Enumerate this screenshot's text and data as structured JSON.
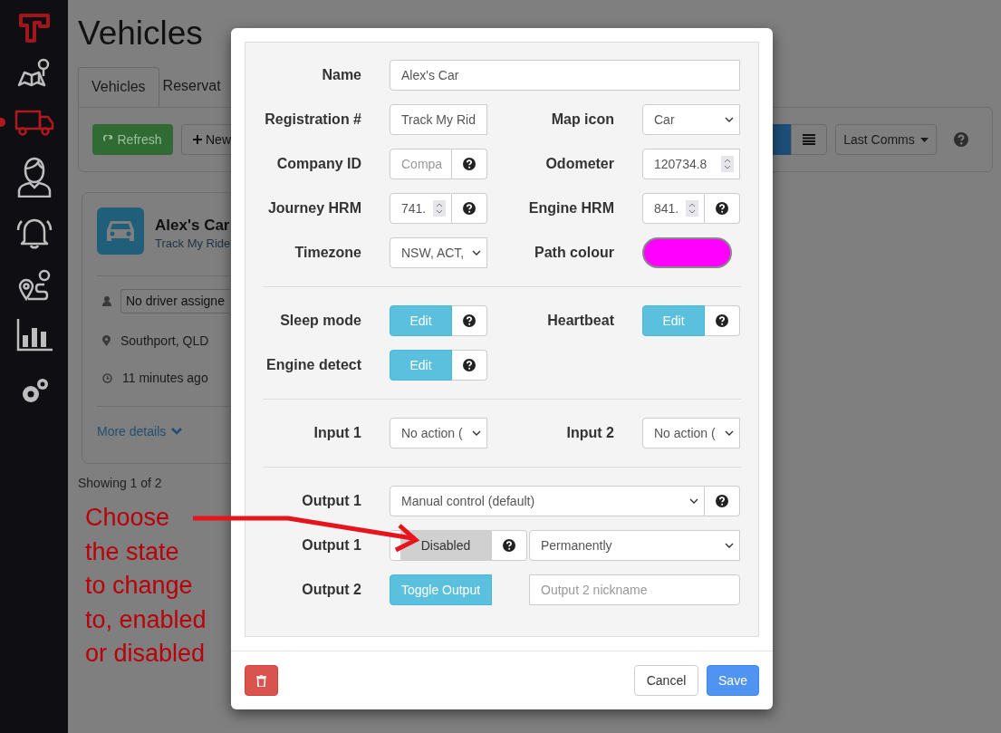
{
  "sidebar": {
    "items": [
      {
        "selected": false
      },
      {
        "selected": true
      },
      {
        "selected": false
      },
      {
        "selected": false
      },
      {
        "selected": false
      },
      {
        "selected": false
      },
      {
        "selected": false
      }
    ]
  },
  "page": {
    "title": "Vehicles",
    "tabs": [
      {
        "label": "Vehicles",
        "selected": true
      },
      {
        "label": "Reservat",
        "selected": false
      }
    ],
    "toolbar": {
      "refresh": "Refresh",
      "new": "New",
      "views": [
        {
          "kind": "grid",
          "selected": true
        },
        {
          "kind": "list",
          "selected": false
        }
      ],
      "sort": "Last Comms"
    },
    "card": {
      "name": "Alex's Car",
      "subtitle": "Track My Ride",
      "driver": "No driver assigne",
      "location": "Southport, QLD",
      "last_seen": "11 minutes ago",
      "more": "More details"
    },
    "count": "Showing 1 of 2"
  },
  "modal": {
    "sections": [
      {
        "rows": [
          {
            "kind": "full",
            "fields": [
              {
                "label": "Name",
                "controls": [
                  {
                    "kind": "text",
                    "value": "Alex's Car"
                  }
                ]
              }
            ]
          },
          {
            "kind": "pair",
            "fields": [
              {
                "label": "Registration #",
                "controls": [
                  {
                    "kind": "text",
                    "value": "Track My Rid"
                  }
                ]
              },
              {
                "label": "Map icon",
                "controls": [
                  {
                    "kind": "select",
                    "value": "Car"
                  }
                ]
              }
            ]
          },
          {
            "kind": "pair",
            "fields": [
              {
                "label": "Company ID",
                "controls": [
                  {
                    "kind": "text",
                    "placeholder": "Compa"
                  },
                  {
                    "kind": "help"
                  }
                ]
              },
              {
                "label": "Odometer",
                "controls": [
                  {
                    "kind": "number",
                    "value": "120734.8"
                  }
                ]
              }
            ]
          },
          {
            "kind": "pair",
            "fields": [
              {
                "label": "Journey HRM",
                "controls": [
                  {
                    "kind": "number",
                    "value": "741."
                  },
                  {
                    "kind": "help"
                  }
                ]
              },
              {
                "label": "Engine HRM",
                "controls": [
                  {
                    "kind": "number",
                    "value": "841."
                  },
                  {
                    "kind": "help"
                  }
                ]
              }
            ]
          },
          {
            "kind": "pair",
            "fields": [
              {
                "label": "Timezone",
                "controls": [
                  {
                    "kind": "select",
                    "value": "NSW, ACT,"
                  }
                ]
              },
              {
                "label": "Path colour",
                "controls": [
                  {
                    "kind": "color",
                    "color": "#ff00ff"
                  }
                ]
              }
            ]
          }
        ]
      },
      {
        "rows": [
          {
            "kind": "pair",
            "fields": [
              {
                "label": "Sleep mode",
                "controls": [
                  {
                    "kind": "button",
                    "label": "Edit"
                  },
                  {
                    "kind": "help"
                  }
                ]
              },
              {
                "label": "Heartbeat",
                "controls": [
                  {
                    "kind": "button",
                    "label": "Edit"
                  },
                  {
                    "kind": "help"
                  }
                ]
              }
            ]
          },
          {
            "kind": "pair",
            "fields": [
              {
                "label": "Engine detect",
                "controls": [
                  {
                    "kind": "button",
                    "label": "Edit"
                  },
                  {
                    "kind": "help"
                  }
                ]
              }
            ]
          }
        ]
      },
      {
        "rows": [
          {
            "kind": "pair",
            "fields": [
              {
                "label": "Input 1",
                "controls": [
                  {
                    "kind": "select",
                    "value": "No action ("
                  }
                ]
              },
              {
                "label": "Input 2",
                "controls": [
                  {
                    "kind": "select",
                    "value": "No action ("
                  }
                ]
              }
            ]
          }
        ]
      },
      {
        "rows": [
          {
            "kind": "full",
            "fields": [
              {
                "label": "Output 1",
                "controls": [
                  {
                    "kind": "select",
                    "value": "Manual control (default)"
                  },
                  {
                    "kind": "help"
                  }
                ]
              }
            ]
          },
          {
            "kind": "full",
            "fields": [
              {
                "label": "Output 1",
                "controls": [
                  {
                    "kind": "toggle",
                    "label": "Disabled",
                    "on": false
                  },
                  {
                    "kind": "help"
                  },
                  {
                    "kind": "select",
                    "value": "Permanently"
                  }
                ]
              }
            ]
          },
          {
            "kind": "full",
            "fields": [
              {
                "label": "Output 2",
                "controls": [
                  {
                    "kind": "button",
                    "label": "Toggle Output"
                  },
                  {
                    "kind": "text",
                    "placeholder": "Output 2 nickname"
                  }
                ]
              }
            ]
          }
        ]
      }
    ],
    "footer": {
      "cancel": "Cancel",
      "save": "Save"
    }
  },
  "annotation": {
    "text": "Choose\nthe state\nto change\nto, enabled\nor disabled"
  }
}
